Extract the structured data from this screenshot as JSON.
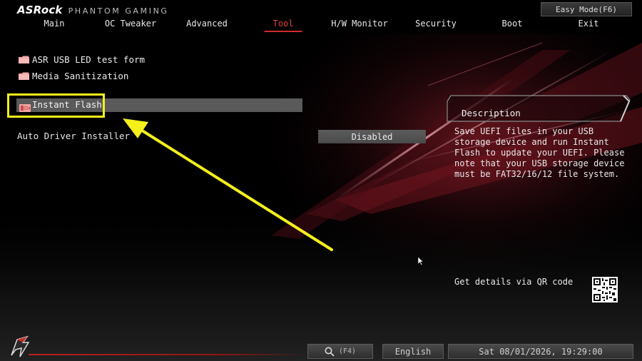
{
  "header": {
    "brand": "ASRock",
    "brand_sub": "PHANTOM GAMING",
    "easy_mode": "Easy Mode(F6)"
  },
  "tabs": [
    {
      "label": "Main",
      "active": false
    },
    {
      "label": "OC Tweaker",
      "active": false
    },
    {
      "label": "Advanced",
      "active": false
    },
    {
      "label": "Tool",
      "active": true
    },
    {
      "label": "H/W Monitor",
      "active": false
    },
    {
      "label": "Security",
      "active": false
    },
    {
      "label": "Boot",
      "active": false
    },
    {
      "label": "Exit",
      "active": false
    }
  ],
  "menu": {
    "items": [
      {
        "label": "ASR USB LED test form",
        "icon": "folder-icon"
      },
      {
        "label": "Media Sanitization",
        "icon": "folder-icon"
      },
      {
        "label": "Instant Flash",
        "icon": "flash-icon",
        "selected": true
      }
    ],
    "option": {
      "label": "Auto Driver Installer",
      "value": "Disabled"
    }
  },
  "description": {
    "title": "Description",
    "text": "Save UEFI files in your USB storage device and run Instant Flash to update your UEFI. Please note that your USB storage device must be FAT32/16/12 file system.",
    "qr_text": "Get details via QR code"
  },
  "footer": {
    "search_key": "(F4)",
    "language": "English",
    "datetime": "Sat 08/01/2026, 19:29:00"
  },
  "colors": {
    "accent_red": "#d02c2a",
    "annotation_yellow": "#f4f01b",
    "selected_row": "#5a5a5a"
  }
}
